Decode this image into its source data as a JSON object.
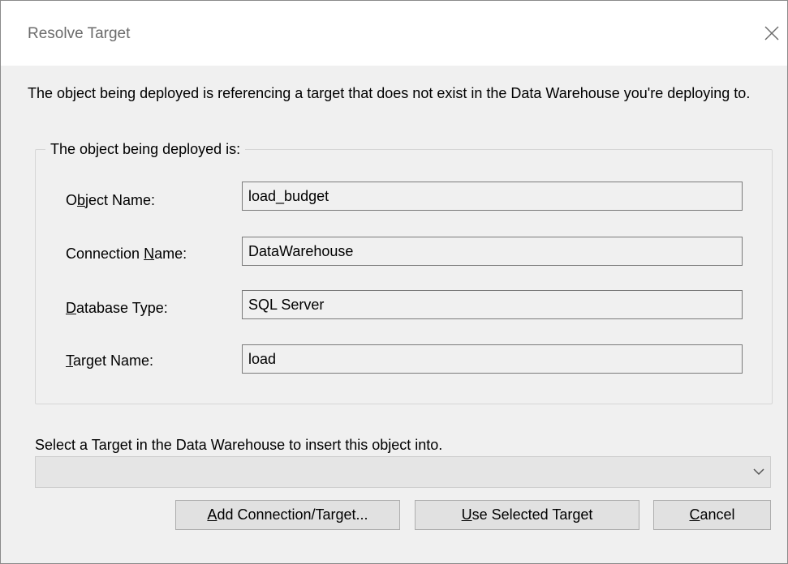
{
  "window": {
    "title": "Resolve Target",
    "close_icon": "close-icon"
  },
  "message": "The object being deployed is referencing a target that does not exist in the Data Warehouse you're deploying to.",
  "group": {
    "label": "The object being deployed is:",
    "fields": [
      {
        "label_pre": "O",
        "label_acc": "b",
        "label_post": "ject Name:",
        "value": "load_budget"
      },
      {
        "label_pre": "Connection ",
        "label_acc": "N",
        "label_post": "ame:",
        "value": "DataWarehouse"
      },
      {
        "label_pre": "",
        "label_acc": "D",
        "label_post": "atabase Type:",
        "value": "SQL Server"
      },
      {
        "label_pre": "",
        "label_acc": "T",
        "label_post": "arget Name:",
        "value": "load"
      }
    ]
  },
  "target_select": {
    "prompt": "Select a Target in the Data Warehouse to insert this object into.",
    "selected_value": "",
    "arrow_icon": "chevron-down-icon"
  },
  "buttons": {
    "add": {
      "acc": "A",
      "rest": "dd Connection/Target..."
    },
    "use": {
      "acc": "U",
      "rest": "se Selected Target"
    },
    "cancel": {
      "acc": "C",
      "rest": "ancel"
    }
  }
}
